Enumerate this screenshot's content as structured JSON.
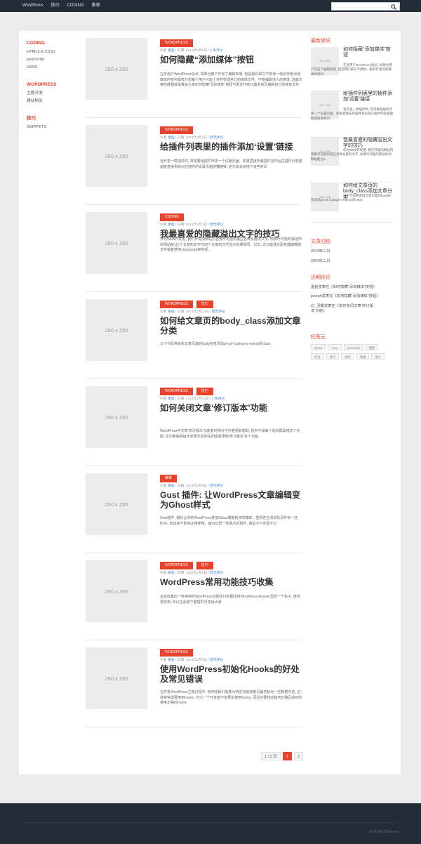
{
  "topnav": [
    "WordPress",
    "技巧",
    "CODING",
    "推荐"
  ],
  "search": {
    "placeholder": "",
    "icon": "search-icon"
  },
  "leftnav": [
    {
      "heading": "CODING",
      "links": [
        "HTML5 & CSS3",
        "javaScript",
        "SASS"
      ]
    },
    {
      "heading": "WORDPRESS",
      "links": [
        "主题开发",
        "建站相关"
      ]
    },
    {
      "heading": "技巧",
      "links": [
        "SNIPPETS"
      ]
    }
  ],
  "placeholder": "250 x 250",
  "posts": [
    {
      "tags": [
        "WORDPRESS"
      ],
      "meta": {
        "author_prefix": "作者 ",
        "author": "墨鱼",
        "date": " / 日期: 2014年3月8日 / ",
        "comments": "2 条评论"
      },
      "title": "如何隐藏“添加媒体”按钮",
      "excerpt": "在多用户WordPress站点, 如果也用户开启了编辑权限, 但是我们却又不想他一级别作者添加媒体的权利或者只想每个用户只能上传并管理自己的媒体文件。不能编辑他人的媒体, 这篇文章的教程就是教会大家如何隐藏“添加媒体”按钮与限定作者只能看到及编辑自己的媒体文件"
    },
    {
      "tags": [
        "WORDPRESS"
      ],
      "meta": {
        "author_prefix": "作者 ",
        "author": "墨鱼",
        "date": " / 日期: 2014年3月7日 / ",
        "comments": "暂无评论"
      },
      "title": "给插件列表里的插件添加‘设置’链接",
      "excerpt": "当开发一款插件时, 常常要给插件开发一个设置页面。如果直接安装插件完毕后在插件列表里面能直接看到对应插件的设置页面快捷链接, 这无疑会给用户省些时间"
    },
    {
      "tags": [
        "CODING"
      ],
      "meta": {
        "author_prefix": "作者 ",
        "author": "墨鱼",
        "date": " / 日期: 2014年3月1日 / ",
        "comments": "暂无评论"
      },
      "title": "我最喜爱的隐藏溢出文字的技巧",
      "excerpt": "作为WEB开发者, 我们开发的网站内容要尽可能的适应各种长度的文字, 你要尽可能的保证你的网站能让5个长度的文字与50个长度的文字显示效果相同。过去, 这只能通过服务器端截取文字或者使用JavaScript来实现..."
    },
    {
      "tags": [
        "WORDPRESS",
        "技巧"
      ],
      "meta": {
        "author_prefix": "作者 ",
        "author": "墨鱼",
        "date": " / 日期: 2014年2月13日 / ",
        "comments": "暂无评论"
      },
      "title": "如何给文章页的body_class添加文章分类",
      "excerpt": "以下代码将会给文章页面的body标签添加gl-cat-{category-name}的class"
    },
    {
      "tags": [
        "WORDPRESS",
        "技巧"
      ],
      "meta": {
        "author_prefix": "作者 ",
        "author": "墨鱼",
        "date": " / 日期: 2014年2月10日 / ",
        "comments": "1 条评论"
      },
      "title": "如何关闭文章‘修订版本’功能",
      "excerpt": "WordPress中文章‘修订版本’功能有时候对于作者很有帮助, 但并不是每个站长都需用这个功能, 这次教程将给大家展示如何关闭或者限制‘修订版本’这个功能。"
    },
    {
      "tags": [
        "推荐"
      ],
      "meta": {
        "author_prefix": "作者 ",
        "author": "墨鱼",
        "date": " / 日期: 2014年2月8日 / ",
        "comments": "暂无评论"
      },
      "title": "Gust 插件: 让WordPress文章编辑变为Ghost样式",
      "excerpt": "Gust插件, 顺利让你的WordPress变成Ghost博客程序的模样。虽然还在测试阶段并有一些BUG, 但这些不影响正常使用。面对这样一款强大的插件, 真是令人欣喜不已"
    },
    {
      "tags": [
        "WORDPRESS",
        "技巧"
      ],
      "meta": {
        "author_prefix": "作者 ",
        "author": "墨鱼",
        "date": " / 日期: 2014年2月6日 / ",
        "comments": "暂无评论"
      },
      "title": "WordPress常用功能技巧收集",
      "excerpt": "这是收集的一些常用的WordPress功能技巧的翻译自WordPress Answer里的一个帖子, 感觉很实用, 所以在此做下整理并分享给大家"
    },
    {
      "tags": [
        "WORDPRESS"
      ],
      "meta": {
        "author_prefix": "作者 ",
        "author": "墨鱼",
        "date": " / 日期: 2014年2月4日 / ",
        "comments": "暂无评论"
      },
      "title": "使用WordPress初始化Hooks的好处及常见错误",
      "excerpt": "在开发WordPress主题过程中, 有时候我们需要为特定功能或者页面初始化一些数据内容, 这就常常需要用到hooks, 作为一个开发者不但要会使用hooks, 而且还要知道如何正确及适时的使用正确的hooks"
    }
  ],
  "pagination": {
    "summary": "1 / 2 页",
    "pages": [
      "1",
      "2"
    ],
    "current": "1"
  },
  "sidebar": {
    "recent_heading": "最新资讯",
    "recent": [
      {
        "title": "如何隐藏“添加媒体”按钮",
        "excerpt": "在多用户WordPress站点, 如果也用户开启了编辑权限, 但是我们却又不想他一级别作者添加媒体的权利..."
      },
      {
        "title": "给插件列表里的插件添加‘设置’链接",
        "excerpt": "当开发一款插件时, 常常要给插件开发一个设置页面。如果直接安装插件完毕后在插件列表里面能直接看到对..."
      },
      {
        "title": "我最喜爱的隐藏溢出文字的技巧",
        "excerpt": "作为WEB开发者, 我们开发的网站内容要尽可能的适应各种长度的文字, 你要尽可能的保证你的网站能让5..."
      },
      {
        "title": "如何给文章页的body_class添加文章分类",
        "excerpt": "以下代码将会给文章页面的body标签添加gl-cat-{category-name}的class"
      }
    ],
    "archive_heading": "文章归档",
    "archives": [
      "2014年三月",
      "2014年二月"
    ],
    "comments_heading": "近期评论",
    "comments": [
      "墨鱼发表在《如何隐藏“添加媒体”按钮》",
      "joseph发表在《如何隐藏“添加媒体”按钮》",
      "幻_羽翼发表在《如何关闭文章‘修订版本’功能》"
    ],
    "tags_heading": "标签云",
    "tags": [
      "Ghost",
      "Gust",
      "javascript",
      "模板",
      "后台",
      "技巧",
      "插件",
      "收藏",
      "语义"
    ]
  },
  "footer": {
    "copyright": "© 2014 JGtheme"
  },
  "colors": {
    "accent": "#e8412c",
    "dark": "#232d38",
    "background": "#ececec"
  }
}
